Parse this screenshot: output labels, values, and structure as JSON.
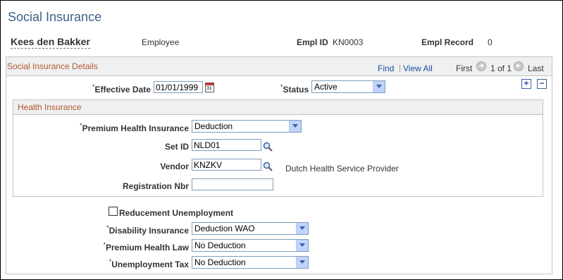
{
  "page": {
    "title": "Social Insurance"
  },
  "employee": {
    "name": "Kees den Bakker",
    "role": "Employee",
    "empl_id_label": "Empl ID",
    "empl_id": "KN0003",
    "empl_record_label": "Empl Record",
    "empl_record": "0"
  },
  "details": {
    "title": "Social Insurance Details",
    "find": "Find",
    "separator": "|",
    "view_all": "View All",
    "first": "First",
    "pager": "1 of 1",
    "last": "Last"
  },
  "effective_date": {
    "label": "Effective Date",
    "value": "01/01/1999"
  },
  "status": {
    "label": "Status",
    "value": "Active"
  },
  "health": {
    "title": "Health Insurance",
    "premium": {
      "label": "Premium Health Insurance",
      "value": "Deduction"
    },
    "setid": {
      "label": "Set ID",
      "value": "NLD01"
    },
    "vendor": {
      "label": "Vendor",
      "value": "KNZKV",
      "description": "Dutch Health Service Provider"
    },
    "registration": {
      "label": "Registration Nbr",
      "value": ""
    }
  },
  "reducement": {
    "label": "Reducement Unemployment",
    "checked": false
  },
  "disability": {
    "label": "Disability Insurance",
    "value": "Deduction WAO"
  },
  "premium_law": {
    "label": "Premium Health Law",
    "value": "No Deduction"
  },
  "unemployment_tax": {
    "label": "Unemployment Tax",
    "value": "No Deduction"
  },
  "required_marker": "*",
  "colors": {
    "title": "#3c5f8a",
    "section": "#b5582b",
    "link": "#1f4d9d"
  }
}
